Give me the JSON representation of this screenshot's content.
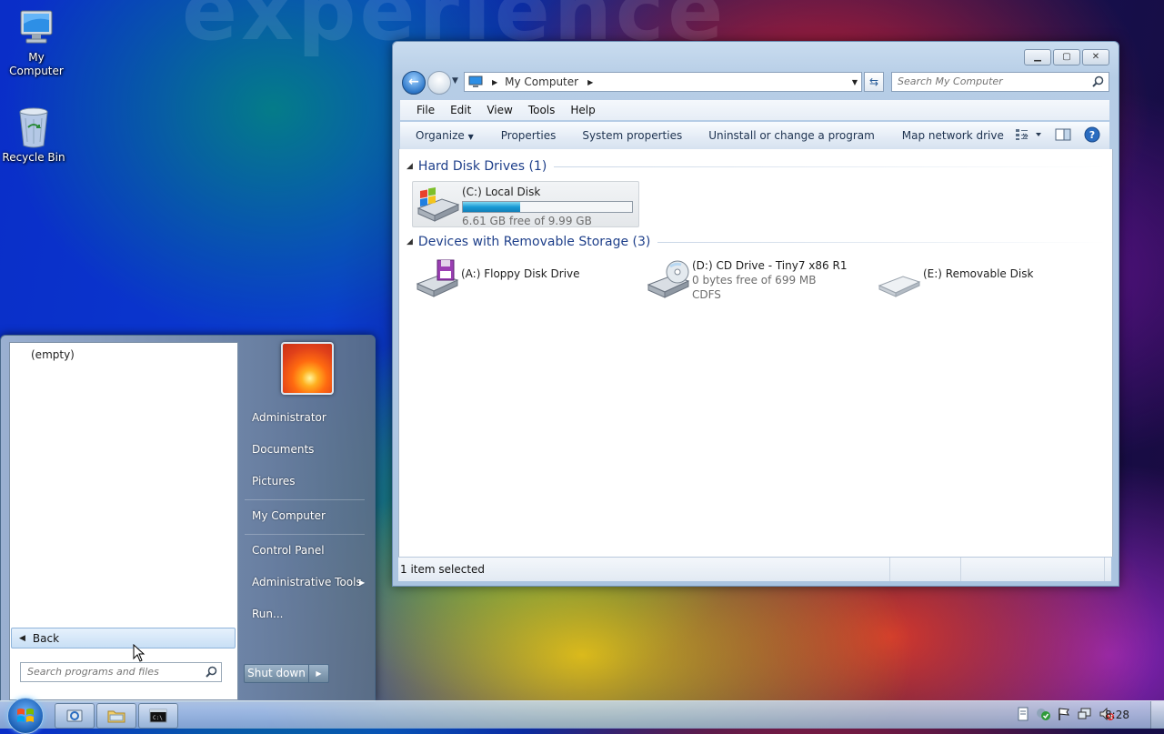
{
  "desktop": {
    "watermark": "experience",
    "icons": [
      {
        "label_line1": "My",
        "label_line2": "Computer"
      },
      {
        "label_line1": "Recycle Bin"
      }
    ]
  },
  "explorer": {
    "address": {
      "location": "My Computer"
    },
    "search": {
      "placeholder": "Search My Computer"
    },
    "menu": [
      "File",
      "Edit",
      "View",
      "Tools",
      "Help"
    ],
    "toolbar": {
      "organize": "Organize",
      "properties": "Properties",
      "system_properties": "System properties",
      "uninstall": "Uninstall or change a program",
      "map_network": "Map network drive",
      "more": "»"
    },
    "groups": [
      {
        "title": "Hard Disk Drives (1)",
        "drives": [
          {
            "name": "(C:) Local Disk",
            "detail": "6.61 GB free of 9.99 GB",
            "used_fraction": 0.34,
            "selected": true
          }
        ]
      },
      {
        "title": "Devices with Removable Storage (3)",
        "drives": [
          {
            "name": "(A:) Floppy Disk Drive"
          },
          {
            "name": "(D:) CD Drive - Tiny7 x86 R1",
            "detail": "0 bytes free of 699 MB",
            "detail2": "CDFS"
          },
          {
            "name": "(E:) Removable Disk"
          }
        ]
      }
    ],
    "status": "1 item selected"
  },
  "start_menu": {
    "empty_label": "(empty)",
    "back_label": "Back",
    "search_placeholder": "Search programs and files",
    "right_links": [
      "Administrator",
      "Documents",
      "Pictures",
      "My Computer",
      "Control Panel",
      "Administrative Tools",
      "Run..."
    ],
    "shutdown_label": "Shut down"
  },
  "taskbar": {
    "clock": "8:28"
  },
  "colors": {
    "accent": "#1e3f8a",
    "progress_fill": "#1a9bd6"
  }
}
